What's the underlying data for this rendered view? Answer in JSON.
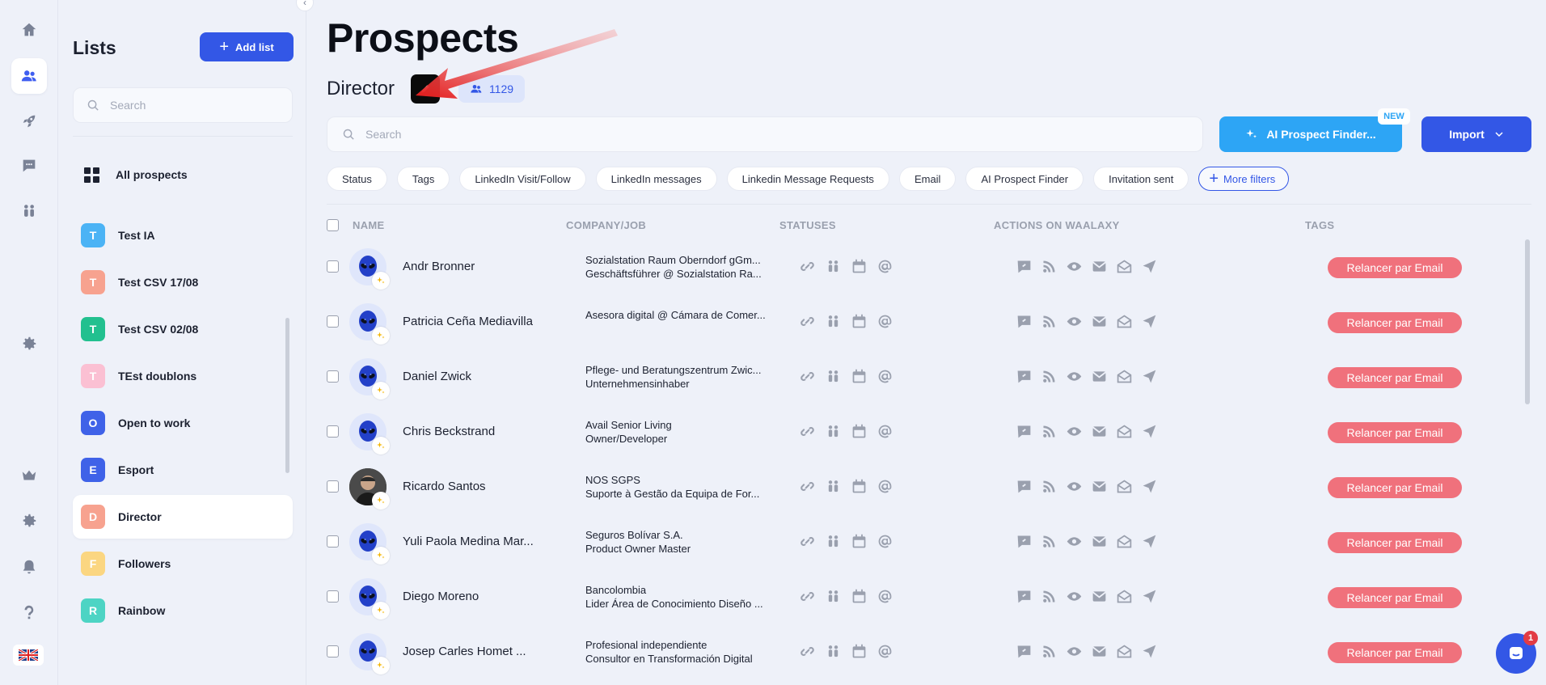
{
  "nav": {
    "items": [
      {
        "name": "home-icon"
      },
      {
        "name": "prospects-icon"
      },
      {
        "name": "rocket-icon"
      },
      {
        "name": "messages-icon"
      },
      {
        "name": "team-icon"
      },
      {
        "name": "settings-icon"
      },
      {
        "name": "crown-icon"
      },
      {
        "name": "settings-icon"
      },
      {
        "name": "bell-icon"
      },
      {
        "name": "help-icon"
      }
    ],
    "flag": "UK flag"
  },
  "lists_panel": {
    "title": "Lists",
    "add_label": "Add list",
    "search_placeholder": "Search",
    "all_prospects": "All prospects",
    "items": [
      {
        "initial": "T",
        "label": "Test IA",
        "color": "#4bb3f5"
      },
      {
        "initial": "T",
        "label": "Test CSV 17/08",
        "color": "#f7a28f"
      },
      {
        "initial": "T",
        "label": "Test CSV 02/08",
        "color": "#22c08f"
      },
      {
        "initial": "T",
        "label": "TEst doublons",
        "color": "#fbc0d3"
      },
      {
        "initial": "O",
        "label": "Open to work",
        "color": "#3f62e8"
      },
      {
        "initial": "E",
        "label": "Esport",
        "color": "#3f62e8"
      },
      {
        "initial": "D",
        "label": "Director",
        "color": "#f7a28f"
      },
      {
        "initial": "F",
        "label": "Followers",
        "color": "#fbd681"
      },
      {
        "initial": "R",
        "label": "Rainbow",
        "color": "#4dd4c4"
      }
    ]
  },
  "main": {
    "title": "Prospects",
    "list_name": "Director",
    "count": "1129",
    "search_placeholder": "Search",
    "ai_finder_label": "AI Prospect Finder...",
    "new_badge": "NEW",
    "import_label": "Import",
    "filters": [
      "Status",
      "Tags",
      "LinkedIn Visit/Follow",
      "LinkedIn messages",
      "Linkedin Message Requests",
      "Email",
      "AI Prospect Finder",
      "Invitation sent"
    ],
    "more_filters": "More filters",
    "columns": {
      "name": "NAME",
      "company": "COMPANY/JOB",
      "statuses": "STATUSES",
      "actions": "ACTIONS ON WAALAXY",
      "tags": "TAGS"
    },
    "rows": [
      {
        "name": "Andr Bronner",
        "company": "Sozialstation Raum Oberndorf gGm...",
        "job": "Geschäftsführer @ Sozialstation Ra...",
        "tag": "Relancer par Email",
        "photo": false
      },
      {
        "name": "Patricia Ceña Mediavilla",
        "company": "Asesora digital @ Cámara de Comer...",
        "job": "",
        "tag": "Relancer par Email",
        "photo": false
      },
      {
        "name": "Daniel Zwick",
        "company": "Pflege- und Beratungszentrum Zwic...",
        "job": "Unternehmensinhaber",
        "tag": "Relancer par Email",
        "photo": false
      },
      {
        "name": "Chris Beckstrand",
        "company": "Avail Senior Living",
        "job": "Owner/Developer",
        "tag": "Relancer par Email",
        "photo": false
      },
      {
        "name": "Ricardo Santos",
        "company": "NOS SGPS",
        "job": "Suporte à Gestão da Equipa de For...",
        "tag": "Relancer par Email",
        "photo": true
      },
      {
        "name": "Yuli Paola Medina Mar...",
        "company": "Seguros Bolívar S.A.",
        "job": "Product Owner Master",
        "tag": "Relancer par Email",
        "photo": false
      },
      {
        "name": "Diego Moreno",
        "company": "Bancolombia",
        "job": "Lider Área de Conocimiento Diseño ...",
        "tag": "Relancer par Email",
        "photo": false
      },
      {
        "name": "Josep Carles Homet ...",
        "company": "Profesional independiente",
        "job": "Consultor en Transformación Digital",
        "tag": "Relancer par Email",
        "photo": false
      }
    ],
    "chat_badge": "1"
  }
}
